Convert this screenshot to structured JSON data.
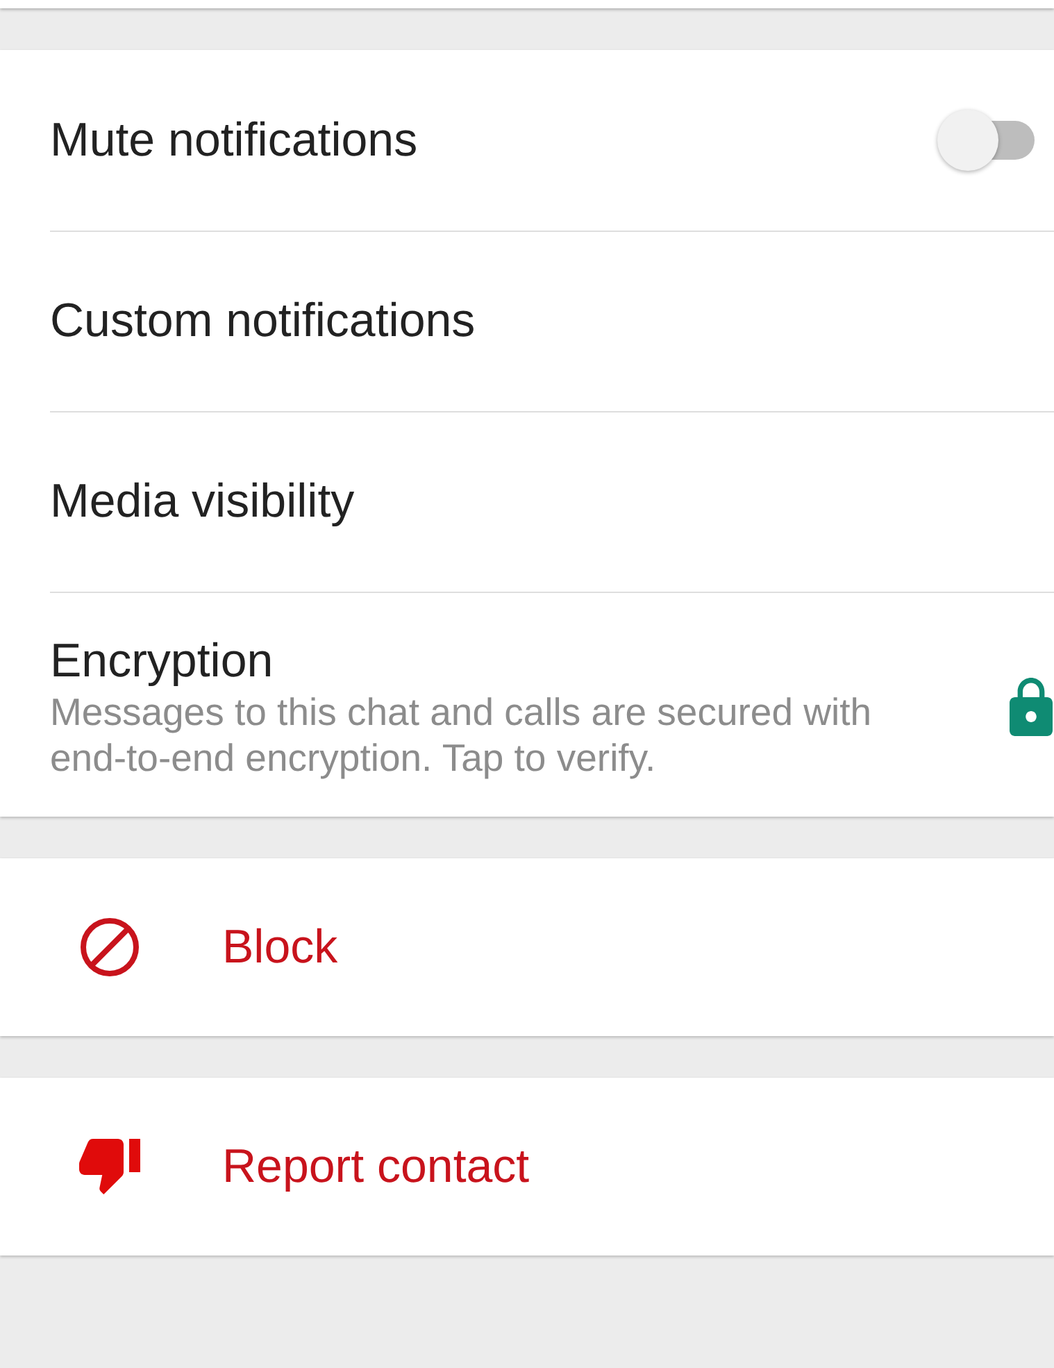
{
  "sections": [
    {
      "items": [
        {
          "kind": "toggle",
          "title": "Mute notifications",
          "on": false
        },
        {
          "kind": "plain",
          "title": "Custom notifications"
        },
        {
          "kind": "plain",
          "title": "Media visibility"
        },
        {
          "kind": "lock",
          "title": "Encryption",
          "subtitle": "Messages to this chat and calls are secured with end-to-end encryption. Tap to verify."
        }
      ]
    },
    {
      "items": [
        {
          "kind": "block",
          "title": "Block"
        }
      ]
    },
    {
      "items": [
        {
          "kind": "report",
          "title": "Report contact"
        }
      ]
    }
  ]
}
